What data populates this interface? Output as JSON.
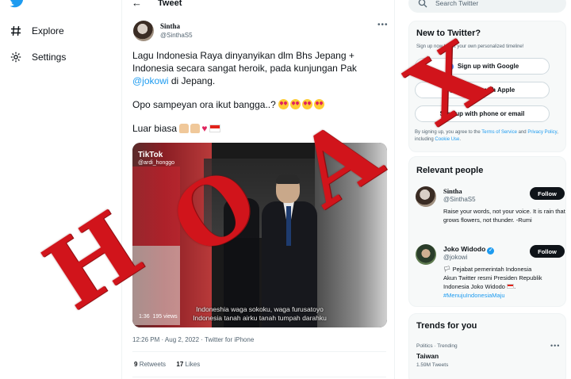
{
  "leftnav": {
    "logo_icon": "twitter-bird-icon",
    "items": [
      {
        "label": "Explore",
        "icon": "hashtag-icon"
      },
      {
        "label": "Settings",
        "icon": "gear-icon"
      }
    ]
  },
  "header": {
    "back_icon": "arrow-left-icon",
    "title": "Tweet"
  },
  "tweet": {
    "author_name": "Sintha",
    "author_handle": "@SinthaS5",
    "text_line1": "Lagu Indonesia Raya dinyanyikan dlm Bhs Jepang + Indonesia secara sangat heroik, pada kunjungan Pak ",
    "mention": "@jokowi",
    "text_line1_end": " di Jepang.",
    "text_line2": "Opo sampeyan ora ikut bangga..?",
    "text_line3": "Luar biasa",
    "media": {
      "watermark": "TikTok",
      "watermark_user": "@ardi_honggo",
      "subtitle_line1": "Indoneshia waga sokoku, waga furusatoyo",
      "subtitle_line2": "Indonesia tanah airku tanah tumpah darahku",
      "duration": "1:36",
      "views": "195 views"
    },
    "timestamp": "12:26 PM · Aug 2, 2022",
    "source": "Twitter for iPhone",
    "retweets_count": "9",
    "retweets_label": "Retweets",
    "likes_count": "17",
    "likes_label": "Likes"
  },
  "sidebar": {
    "search_placeholder": "Search Twitter",
    "new_to_twitter": {
      "title": "New to Twitter?",
      "subtitle": "Sign up now to get your own personalized timeline!",
      "google_label": "Sign up with Google",
      "apple_label": "Sign up with Apple",
      "email_label": "Sign up with phone or email",
      "terms_prefix": "By signing up, you agree to the ",
      "terms_link": "Terms of Service",
      "terms_mid": " and ",
      "privacy_link": "Privacy Policy",
      "terms_mid2": ", including ",
      "cookie_link": "Cookie Use",
      "terms_end": "."
    },
    "relevant_people": {
      "title": "Relevant people",
      "people": [
        {
          "name": "Sintha",
          "handle": "@SinthaS5",
          "follow_label": "Follow",
          "bio": "Raise your words, not your voice. It is rain that grows flowers, not thunder. -Rumi"
        },
        {
          "name": "Joko Widodo",
          "handle": "@jokowi",
          "follow_label": "Follow",
          "bio_line1": "🏳 Pejabat pemerintah Indonesia",
          "bio_line2": "Akun Twitter resmi Presiden Republik Indonesia Joko Widodo",
          "bio_hashtag": "#MenujuIndonesiaMaju"
        }
      ]
    },
    "trends": {
      "title": "Trends for you",
      "items": [
        {
          "context": "Politics · Trending",
          "name": "Taiwan",
          "count": "1.59M Tweets"
        }
      ]
    }
  },
  "overlay": {
    "stamp_letters": [
      "H",
      "O",
      "A",
      "X"
    ],
    "stamp_color": "#d1141b"
  },
  "colors": {
    "accent": "#1d9bf0",
    "text": "#0f1419",
    "muted": "#536471"
  }
}
